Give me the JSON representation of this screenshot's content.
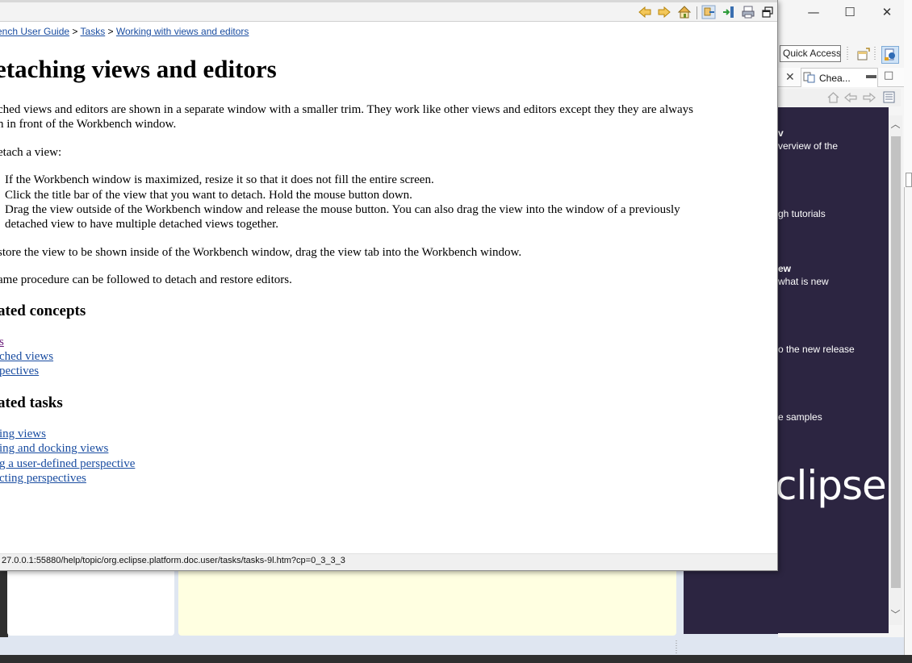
{
  "help": {
    "breadcrumb": {
      "guide": "ench User Guide",
      "sep1": " > ",
      "tasks": "Tasks",
      "sep2": " > ",
      "current": "Working with views and editors"
    },
    "title": "etaching views and editors",
    "intro_line1": "ched views and editors are shown in a separate window with a smaller trim. They work like other views and editors except they they are always",
    "intro_line2": "n in front of the Workbench window.",
    "detach_lead": "etach a view:",
    "steps": [
      "If the Workbench window is maximized, resize it so that it does not fill the entire screen.",
      "Click the title bar of the view that you want to detach. Hold the mouse button down.",
      "Drag the view outside of the Workbench window and release the mouse button. You can also drag the view into the window of a previously",
      "detached view to have multiple detached views together."
    ],
    "restore": "store the view to be shown inside of the Workbench window, drag the view tab into the Workbench window.",
    "same_procedure": "ame procedure can be followed to detach and restore editors.",
    "related_concepts_heading": "ated concepts",
    "related_concepts": [
      "s",
      "ched views",
      "pectives"
    ],
    "related_tasks_heading": "ated tasks",
    "related_tasks": [
      "ing views",
      "ing and docking views",
      "g a user-defined perspective",
      "cting perspectives"
    ],
    "status_url": "27.0.0.1:55880/help/topic/org.eclipse.platform.doc.user/tasks/tasks-9l.htm?cp=0_3_3_3",
    "toolbar_icons": [
      "back-icon",
      "forward-icon",
      "home-icon",
      "show-in-toc-icon",
      "bookmark-icon",
      "print-icon",
      "maximize-icon"
    ]
  },
  "workbench": {
    "quick_access": "Quick Access",
    "cheat_tab_label": "Chea...",
    "window_controls": [
      "—",
      "☐",
      "✕"
    ],
    "welcome_items": [
      {
        "text": "v",
        "bold": true
      },
      {
        "text": "verview of the",
        "bold": false
      },
      {
        "text": "gh tutorials",
        "bold": false
      },
      {
        "text": "ew",
        "bold": true
      },
      {
        "text": "what is new",
        "bold": false
      },
      {
        "text": "o the new release",
        "bold": false
      },
      {
        "text": "e samples",
        "bold": false
      }
    ],
    "logo_text": "clipse"
  },
  "colors": {
    "link": "#1a4da1",
    "visited_link": "#6b1d7b",
    "welcome_bg": "#2c2541",
    "tooltip_bg": "#ffffe1"
  }
}
